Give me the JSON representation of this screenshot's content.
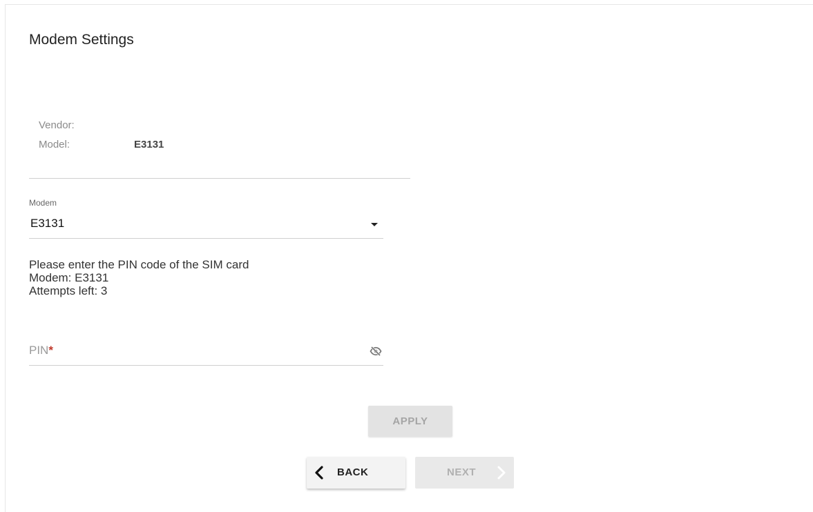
{
  "page": {
    "title": "Modem Settings"
  },
  "device_info": {
    "vendor_label": "Vendor:",
    "vendor_value": "",
    "model_label": "Model:",
    "model_value": "E3131"
  },
  "modem_select": {
    "caption": "Modem",
    "selected": "E3131"
  },
  "pin_prompt": {
    "line1": "Please enter the PIN code of the SIM card",
    "line2": "Modem: E3131",
    "line3": "Attempts left: 3"
  },
  "pin_field": {
    "label": "PIN",
    "required_mark": "*",
    "visibility_icon": "eye-off-icon"
  },
  "buttons": {
    "apply": "APPLY",
    "back": "BACK",
    "next": "NEXT"
  },
  "colors": {
    "required": "#c0392b",
    "disabled_bg": "#e3e3e3",
    "disabled_text": "#a5a5a5"
  }
}
